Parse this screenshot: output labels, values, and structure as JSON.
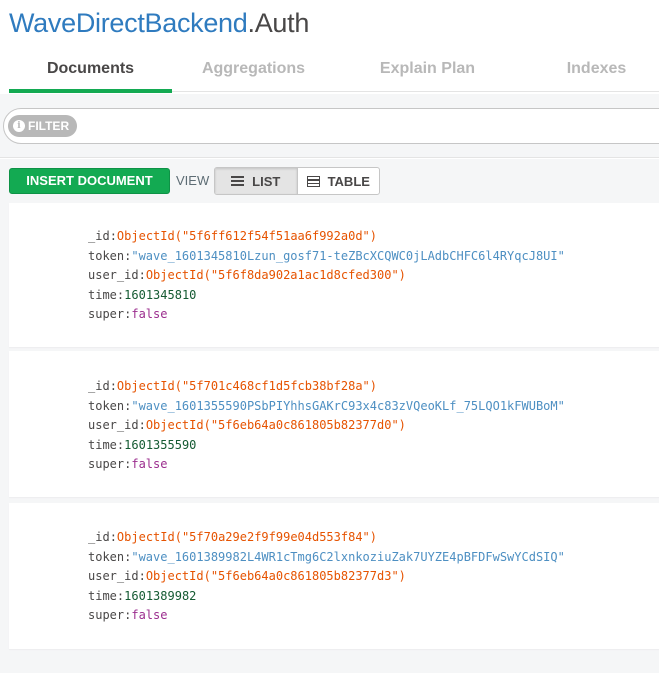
{
  "header": {
    "database": "WaveDirectBackend",
    "collection": ".Auth"
  },
  "tabs": [
    {
      "label": "Documents",
      "active": true
    },
    {
      "label": "Aggregations",
      "active": false
    },
    {
      "label": "Explain Plan",
      "active": false
    },
    {
      "label": "Indexes",
      "active": false
    }
  ],
  "filter": {
    "label": "FILTER",
    "icon": "info-icon"
  },
  "toolbar": {
    "insert_label": "INSERT DOCUMENT",
    "view_label": "VIEW",
    "list_label": "LIST",
    "table_label": "TABLE",
    "active_view": "LIST"
  },
  "documents": [
    {
      "_id": "ObjectId(\"5f6ff612f54f51aa6f992a0d\")",
      "token": "\"wave_1601345810Lzun_gosf71-teZBcXCQWC0jLAdbCHFC6l4RYqcJ8UI\"",
      "user_id": "ObjectId(\"5f6f8da902a1ac1d8cfed300\")",
      "time": "1601345810",
      "super": "false"
    },
    {
      "_id": "ObjectId(\"5f701c468cf1d5fcb38bf28a\")",
      "token": "\"wave_1601355590PSbPIYhhsGAKrC93x4c83zVQeoKLf_75LQO1kFWUBoM\"",
      "user_id": "ObjectId(\"5f6eb64a0c861805b82377d0\")",
      "time": "1601355590",
      "super": "false"
    },
    {
      "_id": "ObjectId(\"5f70a29e2f9f99e04d553f84\")",
      "token": "\"wave_1601389982L4WR1cTmg6C2lxnkoziuZak7UYZE4pBFDFwSwYCdSIQ\"",
      "user_id": "ObjectId(\"5f6eb64a0c861805b82377d3\")",
      "time": "1601389982",
      "super": "false"
    }
  ],
  "field_keys": [
    "_id",
    "token",
    "user_id",
    "time",
    "super"
  ],
  "colors": {
    "accent": "#13aa52",
    "title": "#2f7bbf",
    "objectid": "#e65300",
    "string": "#4d8fc2",
    "number": "#145a32",
    "boolean": "#9b2d8e"
  }
}
